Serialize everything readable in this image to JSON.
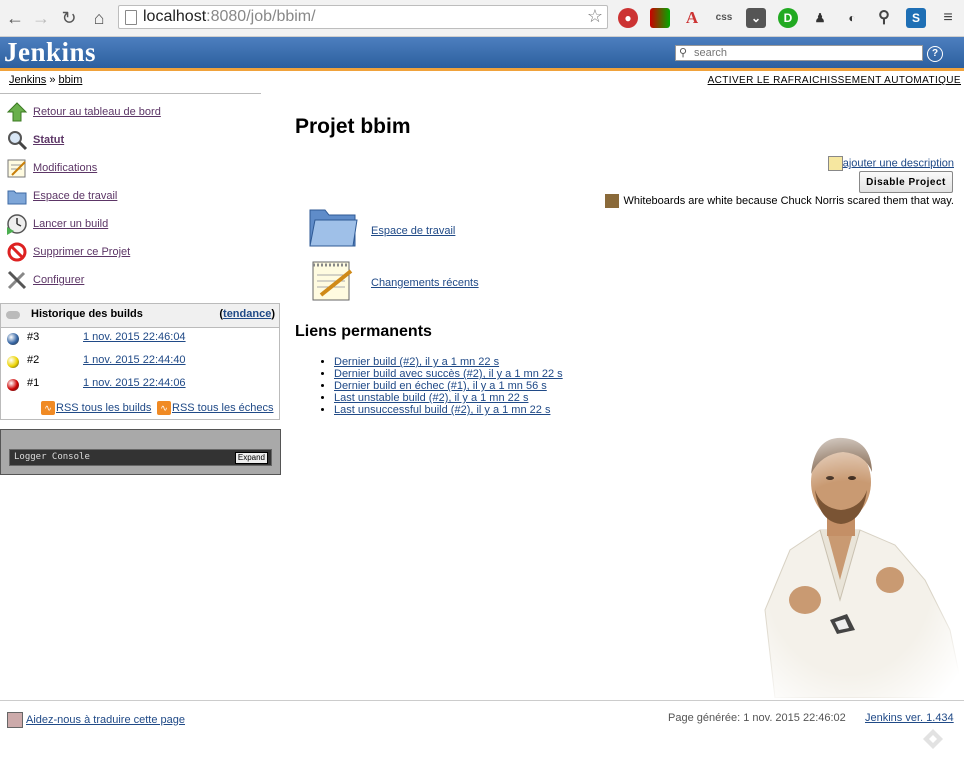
{
  "browser": {
    "url_host": "localhost",
    "url_rest": ":8080/job/bbim/"
  },
  "header": {
    "logo": "Jenkins",
    "search_placeholder": "search",
    "help": "?"
  },
  "breadcrumb": {
    "root": "Jenkins",
    "separator": "»",
    "job": "bbim"
  },
  "autorefresh_label": "ACTIVER LE RAFRAICHISSEMENT AUTOMATIQUE",
  "sidepanel": {
    "tasks": [
      {
        "label": "Retour au tableau de bord",
        "icon": "up-arrow-icon"
      },
      {
        "label": "Statut",
        "icon": "magnifier-icon"
      },
      {
        "label": "Modifications",
        "icon": "notepad-icon"
      },
      {
        "label": "Espace de travail",
        "icon": "folder-icon"
      },
      {
        "label": "Lancer un build",
        "icon": "clock-play-icon"
      },
      {
        "label": "Supprimer ce Projet",
        "icon": "no-entry-icon"
      },
      {
        "label": "Configurer",
        "icon": "wrench-screwdriver-icon"
      }
    ]
  },
  "build_history": {
    "title": "Historique des builds",
    "trend_open": "(",
    "trend": "tendance",
    "trend_close": ")",
    "builds": [
      {
        "number": "#3",
        "date": "1 nov. 2015 22:46:04",
        "status_color": "#3465a4"
      },
      {
        "number": "#2",
        "date": "1 nov. 2015 22:44:40",
        "status_color": "#edd400"
      },
      {
        "number": "#1",
        "date": "1 nov. 2015 22:44:06",
        "status_color": "#cc0000"
      }
    ],
    "rss_all": "RSS tous les builds",
    "rss_failures": "RSS tous les échecs"
  },
  "logger": {
    "title": "Logger Console",
    "expand": "Expand"
  },
  "main": {
    "title": "Projet bbim",
    "add_description": "ajouter une description",
    "disable_button": "Disable Project",
    "quote": "Whiteboards are white because Chuck Norris scared them that way.",
    "links": [
      {
        "label": "Espace de travail",
        "icon": "folder-icon"
      },
      {
        "label": "Changements récents",
        "icon": "notepad-icon"
      }
    ],
    "permalinks_title": "Liens permanents",
    "permalinks": [
      "Dernier build (#2), il y a 1 mn 22 s",
      "Dernier build avec succès (#2), il y a 1 mn 22 s",
      "Dernier build en échec (#1), il y a 1 mn 56 s",
      "Last unstable build (#2), il y a 1 mn 22 s",
      "Last unsuccessful build (#2), il y a 1 mn 22 s"
    ]
  },
  "footer": {
    "translate": "Aidez-nous à traduire cette page",
    "generated": "Page générée: 1 nov. 2015 22:46:02",
    "version": "Jenkins ver. 1.434"
  }
}
